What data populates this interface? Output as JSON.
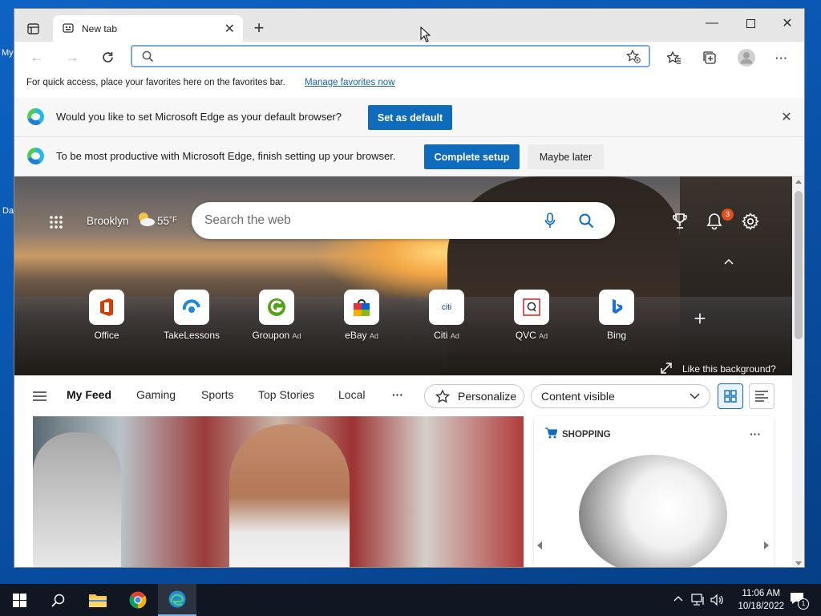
{
  "desktop": {
    "icon_label_1": "My",
    "icon_label_2": "Da"
  },
  "browser": {
    "tab": {
      "title": "New tab"
    },
    "address_bar": {
      "value": "",
      "placeholder": ""
    },
    "favorites_bar": {
      "message": "For quick access, place your favorites here on the favorites bar.",
      "link": "Manage favorites now"
    },
    "default_prompt": {
      "message": "Would you like to set Microsoft Edge as your default browser?",
      "button": "Set as default"
    },
    "setup_prompt": {
      "message": "To be most productive with Microsoft Edge, finish setting up your browser.",
      "primary": "Complete setup",
      "secondary": "Maybe later"
    }
  },
  "newtab": {
    "weather": {
      "city": "Brooklyn",
      "temp": "55",
      "unit": "°F"
    },
    "search": {
      "placeholder": "Search the web"
    },
    "notifications_count": "3",
    "tiles": [
      {
        "label": "Office",
        "ad": ""
      },
      {
        "label": "TakeLessons",
        "ad": ""
      },
      {
        "label": "Groupon",
        "ad": "Ad"
      },
      {
        "label": "eBay",
        "ad": "Ad"
      },
      {
        "label": "Citi",
        "ad": "Ad"
      },
      {
        "label": "QVC",
        "ad": "Ad"
      },
      {
        "label": "Bing",
        "ad": ""
      }
    ],
    "citi_text": "citi",
    "background_link": "Like this background?",
    "feed_nav": {
      "items": [
        "My Feed",
        "Gaming",
        "Sports",
        "Top Stories",
        "Local"
      ],
      "more": "···",
      "personalize": "Personalize",
      "content_select": "Content visible"
    },
    "shopping": {
      "label": "SHOPPING",
      "more": "···"
    }
  },
  "taskbar": {
    "time": "11:06 AM",
    "date": "10/18/2022",
    "notification_count": "1"
  },
  "colors": {
    "accent": "#0f6cbd",
    "taskbar": "#101722",
    "badge": "#e0501e"
  }
}
